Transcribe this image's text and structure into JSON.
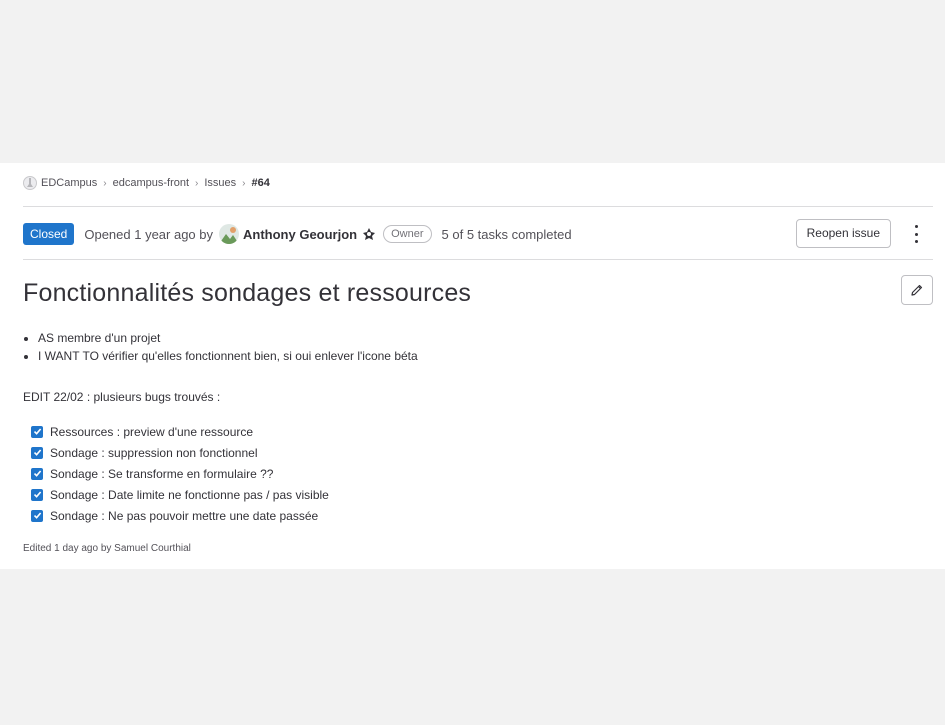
{
  "breadcrumb": {
    "items": [
      "EDCampus",
      "edcampus-front",
      "Issues",
      "#64"
    ],
    "separator": "›"
  },
  "issue_header": {
    "status": "Closed",
    "opened_text": "Opened 1 year ago by",
    "author": "Anthony Geourjon",
    "role": "Owner",
    "tasks_summary": "5 of 5 tasks completed",
    "reopen_label": "Reopen issue"
  },
  "title": "Fonctionnalités sondages et ressources",
  "description": {
    "bullets": [
      "AS membre d'un projet",
      "I WANT TO vérifier qu'elles fonctionnent bien, si oui enlever l'icone béta"
    ],
    "edit_note": "EDIT 22/02 : plusieurs bugs trouvés :",
    "tasks": [
      {
        "label": "Ressources : preview d'une ressource",
        "checked": true
      },
      {
        "label": "Sondage : suppression non fonctionnel",
        "checked": true
      },
      {
        "label": "Sondage : Se transforme en formulaire ??",
        "checked": true
      },
      {
        "label": "Sondage : Date limite ne fonctionne pas / pas visible",
        "checked": true
      },
      {
        "label": "Sondage : Ne pas pouvoir mettre une date passée",
        "checked": true
      }
    ]
  },
  "edited_by": "Edited 1 day ago by Samuel Courthial",
  "colors": {
    "closed_badge": "#1f75cb",
    "checkbox": "#1f75cb"
  },
  "icons": [
    "project-avatar-icon",
    "chevron-right-icon",
    "user-avatar",
    "pencil-icon",
    "kebab-menu-icon",
    "checkbox-checked-icon"
  ]
}
